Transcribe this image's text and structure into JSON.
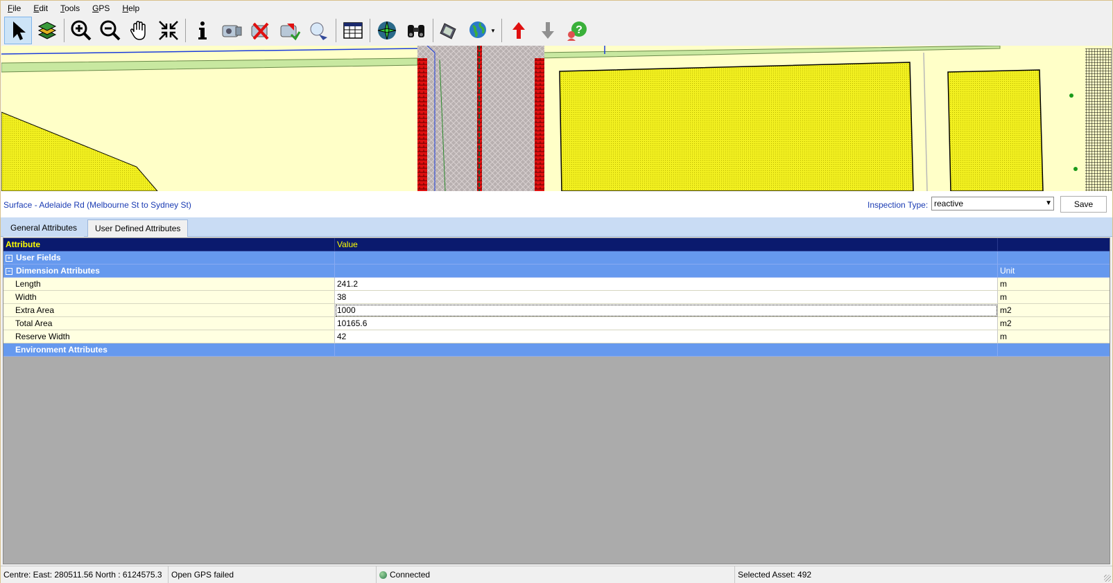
{
  "menu": [
    {
      "label": "File",
      "accel": "F",
      "rest": "ile"
    },
    {
      "label": "Edit",
      "accel": "E",
      "rest": "dit"
    },
    {
      "label": "Tools",
      "accel": "T",
      "rest": "ools"
    },
    {
      "label": "GPS",
      "accel": "G",
      "rest": "PS"
    },
    {
      "label": "Help",
      "accel": "H",
      "rest": "elp"
    }
  ],
  "toolbar_icons": [
    "select-arrow-icon",
    "layers-icon",
    "zoom-in-icon",
    "zoom-out-icon",
    "pan-hand-icon",
    "zoom-extent-icon",
    "info-icon",
    "camera-icon",
    "delete-camera-icon",
    "inspect-camera-icon",
    "search-map-icon",
    "table-icon",
    "compass-icon",
    "binoculars-icon",
    "gps-device-icon",
    "globe-icon",
    "up-arrow-icon",
    "down-arrow-icon",
    "help-icon"
  ],
  "asset": {
    "title": "Surface - Adelaide Rd (Melbourne St to Sydney St)",
    "inspection_label": "Inspection Type:",
    "inspection_value": "reactive",
    "save_label": "Save"
  },
  "tabs": [
    {
      "label": "General Attributes",
      "selected": false
    },
    {
      "label": "User Defined Attributes",
      "selected": true
    }
  ],
  "grid": {
    "headers": {
      "attribute": "Attribute",
      "value": "Value",
      "unit": ""
    },
    "groups": {
      "user_fields": {
        "label": "User Fields",
        "expander": "+"
      },
      "dimension": {
        "label": "Dimension Attributes",
        "expander": "−",
        "unit_header": "Unit"
      },
      "environment": {
        "label": "Environment Attributes"
      }
    },
    "rows": [
      {
        "attribute": "Length",
        "value": "241.2",
        "unit": "m"
      },
      {
        "attribute": "Width",
        "value": "38",
        "unit": "m"
      },
      {
        "attribute": "Extra Area",
        "value": "1000",
        "unit": "m2"
      },
      {
        "attribute": "Total Area",
        "value": "10165.6",
        "unit": "m2"
      },
      {
        "attribute": "Reserve Width",
        "value": "42",
        "unit": "m"
      }
    ]
  },
  "status": {
    "centre": "Centre:  East:  280511.56   North  : 6124575.3",
    "gps": "Open GPS failed",
    "connection": "Connected",
    "selected": "Selected Asset: 492"
  },
  "colors": {
    "grid_header_bg": "#0a1a6e",
    "grid_header_text": "#ffff00",
    "group_row_bg": "#6699ee",
    "attribute_cell_bg": "#ffffe1",
    "link_text": "#1a3bb3"
  }
}
